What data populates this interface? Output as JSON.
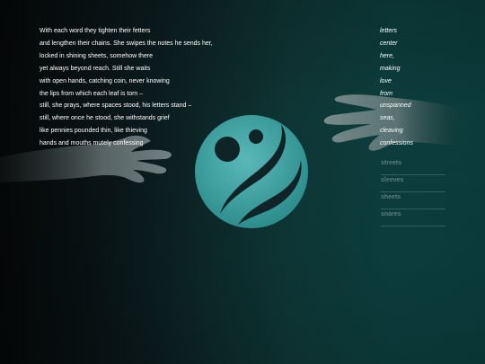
{
  "poem": {
    "lines": [
      "With each word they tighten their fetters",
      "and lengthen their chains. She swipes the notes he sends her,",
      "locked in shining sheets, somehow there",
      "yet always beyond reach. Still she waits",
      "with open hands, catching coin, never knowing",
      "the lips from which each leaf is torn –",
      "still, she prays, where spaces stood, his letters stand –",
      "still, where once he stood, she withstands grief",
      "like pennies pounded thin, like thieving",
      "hands and mouths mutely confessing"
    ]
  },
  "word_column": {
    "words": [
      "letters",
      "center",
      "here,",
      "making",
      "love",
      "from",
      "unspanned",
      "seas,",
      "cleaving",
      "confessions"
    ]
  },
  "options": {
    "items": [
      "streets",
      "sleeves",
      "sheets",
      "snares"
    ]
  },
  "colors": {
    "emblem_teal": "#3aa3a3",
    "background_dark": "#050708",
    "background_teal": "#0d3c3c"
  },
  "icons": {
    "emblem": "swirl-emblem-icon",
    "left_hand": "open-hand-image",
    "right_hand": "reaching-hand-image"
  }
}
